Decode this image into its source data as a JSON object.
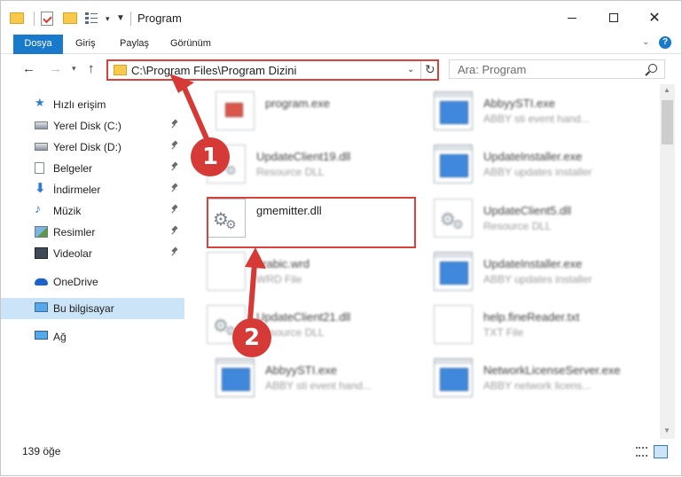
{
  "window": {
    "title": "Program",
    "controls": {
      "minimize": "",
      "maximize": "",
      "close": "✕"
    }
  },
  "quick_access_toolbar": {
    "dropdown": "▾",
    "customize": "▼"
  },
  "ribbon": {
    "tabs": [
      "Dosya",
      "Giriş",
      "Paylaş",
      "Görünüm"
    ],
    "expand": "⌄",
    "help": "?"
  },
  "navigation": {
    "back": "←",
    "forward": "→",
    "recent": "▾",
    "up": "↑",
    "address": "C:\\Program Files\\Program Dizini",
    "address_dropdown": "⌄",
    "refresh": "↻",
    "search_placeholder": "Ara: Program"
  },
  "sidebar": {
    "items": [
      {
        "label": "Hızlı erişim",
        "icon": "star-icon",
        "pinned": false
      },
      {
        "label": "Yerel Disk (C:)",
        "icon": "drive-icon",
        "pinned": true
      },
      {
        "label": "Yerel Disk (D:)",
        "icon": "drive-icon",
        "pinned": true
      },
      {
        "label": "Belgeler",
        "icon": "documents-icon",
        "pinned": true
      },
      {
        "label": "İndirmeler",
        "icon": "download-icon",
        "pinned": true
      },
      {
        "label": "Müzik",
        "icon": "music-icon",
        "pinned": true
      },
      {
        "label": "Resimler",
        "icon": "pictures-icon",
        "pinned": true
      },
      {
        "label": "Videolar",
        "icon": "videos-icon",
        "pinned": true
      },
      {
        "label": "OneDrive",
        "icon": "cloud-icon",
        "pinned": false
      },
      {
        "label": "Bu bilgisayar",
        "icon": "computer-icon",
        "pinned": false,
        "selected": true
      },
      {
        "label": "Ağ",
        "icon": "network-icon",
        "pinned": false
      }
    ]
  },
  "files": [
    {
      "name": "program.exe",
      "type": "",
      "icon": "program-exe-icon"
    },
    {
      "name": "AbbyySTI.exe",
      "type": "ABBY sti event hand...",
      "icon": "exe-icon"
    },
    {
      "name": "UpdateClient19.dll",
      "type": "Resource DLL",
      "icon": "dll-icon"
    },
    {
      "name": "UpdateInstaller.exe",
      "type": "ABBY updates installer",
      "icon": "exe-icon"
    },
    {
      "name": "gmemitter.dll",
      "type": "",
      "icon": "dll-icon",
      "highlighted": true
    },
    {
      "name": "UpdateClient5.dll",
      "type": "Resource DLL",
      "icon": "dll-icon"
    },
    {
      "name": "arabic.wrd",
      "type": "WRD File",
      "icon": "file-icon"
    },
    {
      "name": "UpdateInstaller.exe",
      "type": "ABBY updates installer",
      "icon": "exe-icon"
    },
    {
      "name": "UpdateClient21.dll",
      "type": "Resource DLL",
      "icon": "dll-icon"
    },
    {
      "name": "help.fineReader.txt",
      "type": "TXT File",
      "icon": "txt-icon"
    },
    {
      "name": "AbbyySTI.exe",
      "type": "ABBY sti event hand...",
      "icon": "exe-icon"
    },
    {
      "name": "NetworkLicenseServer.exe",
      "type": "ABBY network licens...",
      "icon": "exe-icon"
    }
  ],
  "status": {
    "count": "139 öğe"
  },
  "scrollbar": {
    "up": "▲",
    "down": "▼"
  },
  "annotations": {
    "step1": "1",
    "step2": "2",
    "color": "#d63a36"
  }
}
